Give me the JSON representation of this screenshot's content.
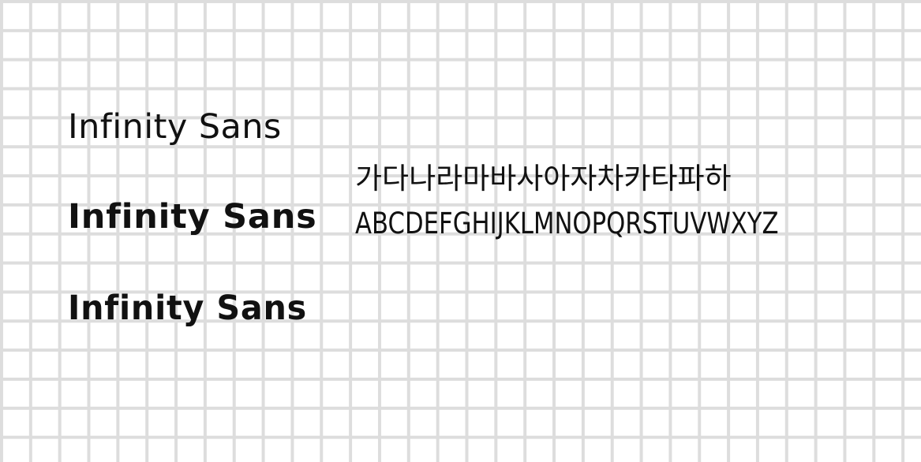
{
  "samples": [
    {
      "text": "Infinity Sans",
      "weight": "Regular"
    },
    {
      "text": "Infinity Sans",
      "weight": "Bold"
    },
    {
      "text": "Infinity Sans",
      "weight": "Black"
    }
  ],
  "charset": {
    "hangul": "가다나라마바사아자차카타파하",
    "latin": "ABCDEFGHIJKLMNOPQRSTUVWXYZ"
  },
  "colors": {
    "background": "#ffffff",
    "grid_line": "#dddddd",
    "text": "#111111"
  }
}
